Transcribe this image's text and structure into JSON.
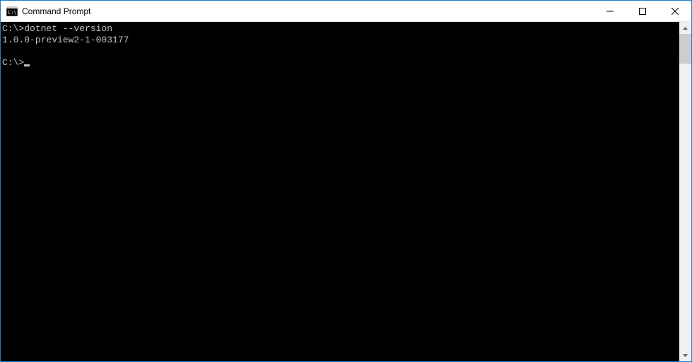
{
  "window": {
    "title": "Command Prompt"
  },
  "terminal": {
    "lines": [
      {
        "prompt": "C:\\>",
        "command": "dotnet --version"
      },
      {
        "output": "1.0.0-preview2-1-003177"
      },
      {
        "output": ""
      },
      {
        "prompt": "C:\\>",
        "cursor": true
      }
    ]
  }
}
